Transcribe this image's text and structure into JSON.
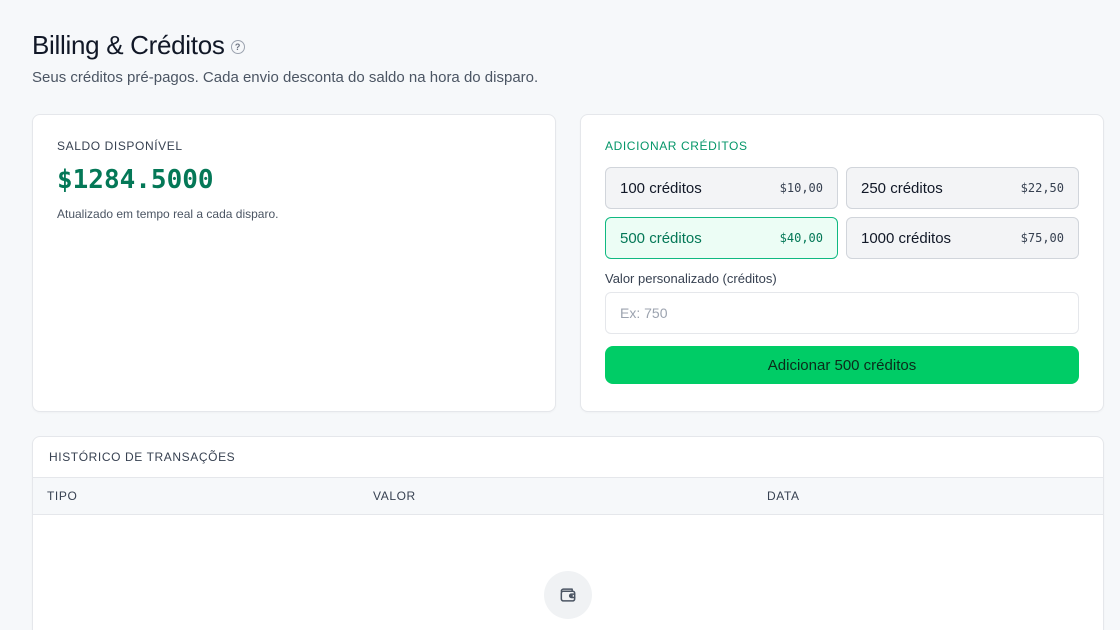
{
  "header": {
    "title": "Billing & Créditos",
    "subtitle": "Seus créditos pré-pagos. Cada envio desconta do saldo na hora do disparo."
  },
  "balance": {
    "label": "SALDO DISPONÍVEL",
    "value": "$1284.5000",
    "note": "Atualizado em tempo real a cada disparo."
  },
  "credits": {
    "label": "ADICIONAR CRÉDITOS",
    "packages": [
      {
        "name": "100 créditos",
        "price": "$10,00",
        "selected": false
      },
      {
        "name": "250 créditos",
        "price": "$22,50",
        "selected": false
      },
      {
        "name": "500 créditos",
        "price": "$40,00",
        "selected": true
      },
      {
        "name": "1000 créditos",
        "price": "$75,00",
        "selected": false
      }
    ],
    "custom_label": "Valor personalizado (créditos)",
    "custom_placeholder": "Ex: 750",
    "custom_value": "",
    "add_button": "Adicionar 500 créditos"
  },
  "history": {
    "title": "HISTÓRICO DE TRANSAÇÕES",
    "columns": [
      "TIPO",
      "VALOR",
      "DATA"
    ]
  },
  "colors": {
    "accent": "#00cc66",
    "balance": "#047857",
    "selected_border": "#10b981",
    "selected_bg": "#ecfdf5"
  },
  "icons": {
    "help": "help-circle-icon",
    "empty": "wallet-icon"
  }
}
